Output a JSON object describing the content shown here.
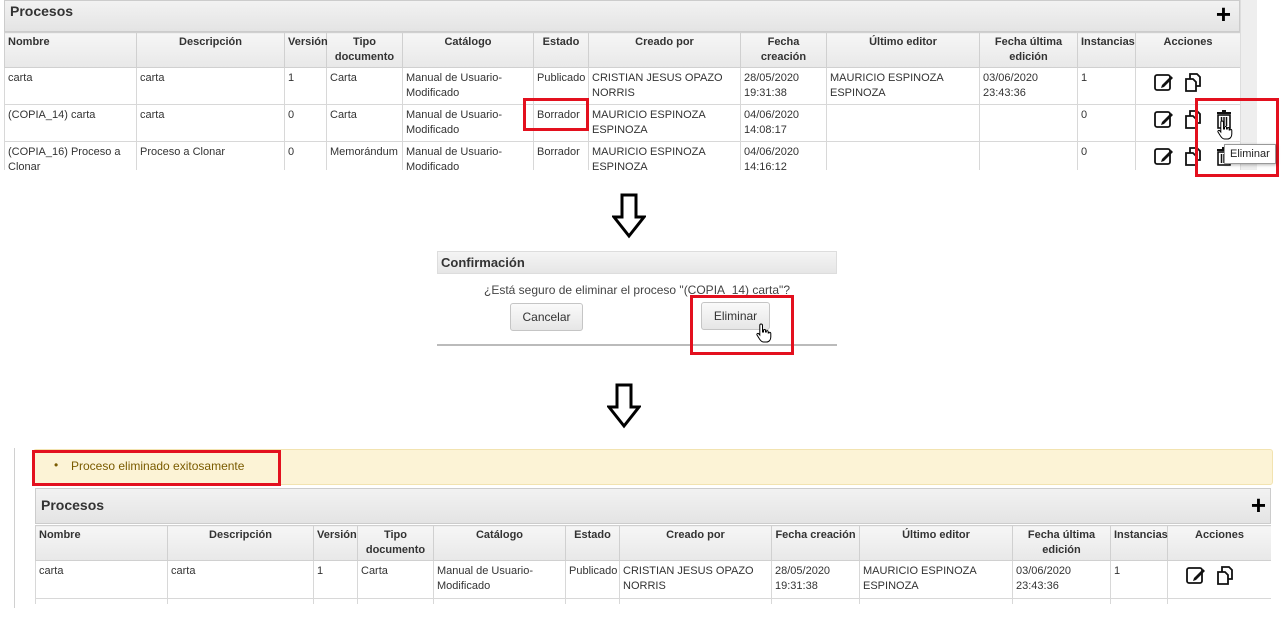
{
  "top_panel": {
    "title": "Procesos",
    "add_symbol": "+",
    "columns": [
      "Nombre",
      "Descripción",
      "Versión",
      "Tipo documento",
      "Catálogo",
      "Estado",
      "Creado por",
      "Fecha creación",
      "Último editor",
      "Fecha última edición",
      "Instancias",
      "Acciones"
    ],
    "rows": [
      {
        "nombre": "carta",
        "descripcion": "carta",
        "version": "1",
        "tipo": "Carta",
        "catalogo": "Manual de Usuario-Modificado",
        "estado": "Publicado",
        "creado": "CRISTIAN JESUS OPAZO NORRIS",
        "fecha": "28/05/2020 19:31:38",
        "editor": "MAURICIO ESPINOZA ESPINOZA",
        "fecha_ed": "03/06/2020 23:43:36",
        "instancias": "1"
      },
      {
        "nombre": "(COPIA_14) carta",
        "descripcion": "carta",
        "version": "0",
        "tipo": "Carta",
        "catalogo": "Manual de Usuario-Modificado",
        "estado": "Borrador",
        "creado": "MAURICIO ESPINOZA ESPINOZA",
        "fecha": "04/06/2020 14:08:17",
        "editor": "",
        "fecha_ed": "",
        "instancias": "0"
      },
      {
        "nombre": "(COPIA_16) Proceso a Clonar",
        "descripcion": "Proceso a Clonar",
        "version": "0",
        "tipo": "Memorándum",
        "catalogo": "Manual de Usuario-Modificado",
        "estado": "Borrador",
        "creado": "MAURICIO ESPINOZA ESPINOZA",
        "fecha": "04/06/2020 14:16:12",
        "editor": "",
        "fecha_ed": "",
        "instancias": "0"
      }
    ],
    "tooltip": "Eliminar"
  },
  "dialog": {
    "title": "Confirmación",
    "message": "¿Está seguro de eliminar el proceso \"(COPIA_14) carta\"?",
    "cancel_label": "Cancelar",
    "confirm_label": "Eliminar"
  },
  "bottom": {
    "message": "Proceso eliminado exitosamente",
    "title": "Procesos",
    "add_symbol": "+",
    "columns": [
      "Nombre",
      "Descripción",
      "Versión",
      "Tipo documento",
      "Catálogo",
      "Estado",
      "Creado por",
      "Fecha creación",
      "Último editor",
      "Fecha última edición",
      "Instancias",
      "Acciones"
    ],
    "rows": [
      {
        "nombre": "carta",
        "descripcion": "carta",
        "version": "1",
        "tipo": "Carta",
        "catalogo": "Manual de Usuario-Modificado",
        "estado": "Publicado",
        "creado": "CRISTIAN JESUS OPAZO NORRIS",
        "fecha": "28/05/2020 19:31:38",
        "editor": "MAURICIO ESPINOZA ESPINOZA",
        "fecha_ed": "03/06/2020 23:43:36",
        "instancias": "1"
      }
    ]
  },
  "icons": {
    "edit": "edit-icon",
    "copy": "copy-icon",
    "delete": "trash-icon",
    "arrow": "down-arrow-icon"
  },
  "colors": {
    "highlight": "#e3101e",
    "success_bg": "#fcf3d6",
    "success_text": "#7a5b00"
  }
}
